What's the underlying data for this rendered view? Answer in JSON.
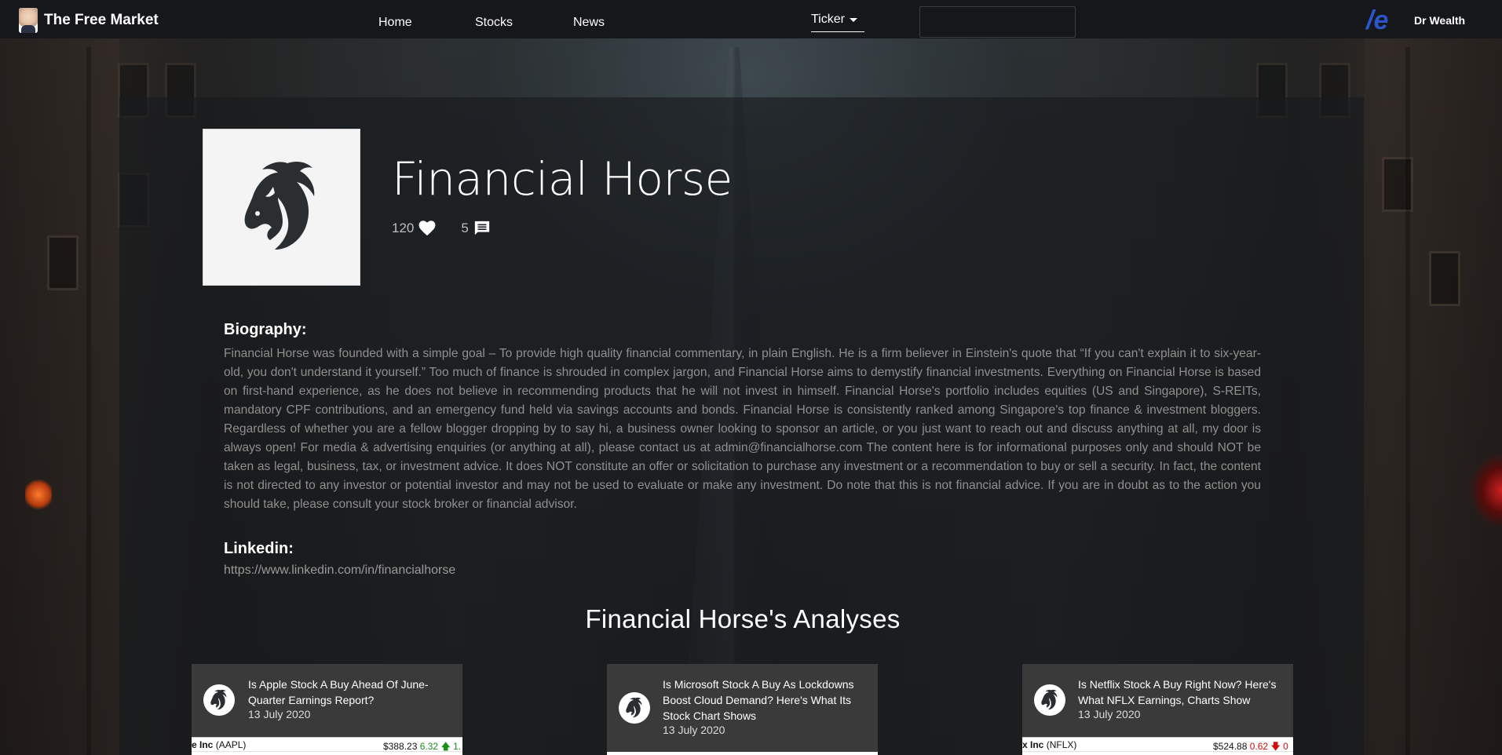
{
  "navbar": {
    "brand": "The Free Market",
    "links": [
      "Home",
      "Stocks",
      "News"
    ],
    "ticker_label": "Ticker",
    "search_placeholder": "",
    "user_name": "Dr Wealth",
    "logo_letter": "/e"
  },
  "profile": {
    "name": "Financial Horse",
    "likes": "120",
    "comments": "5"
  },
  "biography": {
    "heading": "Biography:",
    "text": "Financial Horse was founded with a simple goal – To provide high quality financial commentary, in plain English.  He is a firm believer in Einstein's quote that “If you can't explain it to six-year-old, you don't understand it yourself.” Too much of finance is shrouded in complex jargon, and Financial Horse aims to demystify financial investments.  Everything on Financial Horse is based on first-hand experience, as he does not believe in recommending products that he will not invest in himself.  Financial Horse's portfolio includes equities (US and Singapore), S-REITs, mandatory CPF contributions, and an emergency fund held via savings accounts and bonds.  Financial Horse is consistently ranked among Singapore's top finance & investment bloggers. Regardless of whether you are a fellow blogger dropping by to say hi, a business owner looking to sponsor an article, or you just want to reach out and discuss anything at all, my door is always open!  For media & advertising enquiries (or anything at all), please contact us at admin@financialhorse.com  The content here is for informational purposes only and should NOT be taken as legal, business, tax, or investment advice. It does NOT constitute an offer or solicitation to purchase any investment or a recommendation to buy or sell a security. In fact, the content is not directed to any investor or potential investor and may not be used to evaluate or make any investment.  Do note that this is not financial advice. If you are in doubt as to the action you should take, please consult your stock broker or financial advisor."
  },
  "linkedin": {
    "heading": "Linkedin:",
    "url": "https://www.linkedin.com/in/financialhorse"
  },
  "analyses": {
    "heading": "Financial Horse's Analyses",
    "cards": [
      {
        "title": "Is Apple Stock A Buy Ahead Of June-Quarter Earnings Report?",
        "date": "13 July 2020",
        "ticker_name": "e Inc",
        "ticker_symbol": "(AAPL)",
        "price": "$388.23",
        "change": "6.32",
        "change_pct": "1.",
        "direction": "up"
      },
      {
        "title": "Is Microsoft Stock A Buy As Lockdowns Boost Cloud Demand? Here's What Its Stock Chart Shows",
        "date": "13 July 2020",
        "ticker_name": "",
        "ticker_symbol": "",
        "price": "",
        "change": "",
        "change_pct": "",
        "direction": "none"
      },
      {
        "title": "Is Netflix Stock A Buy Right Now? Here's What NFLX Earnings, Charts Show",
        "date": "13 July 2020",
        "ticker_name": "x Inc",
        "ticker_symbol": "(NFLX)",
        "price": "$524.88",
        "change": "0.62",
        "change_pct": "0",
        "direction": "down"
      }
    ]
  }
}
